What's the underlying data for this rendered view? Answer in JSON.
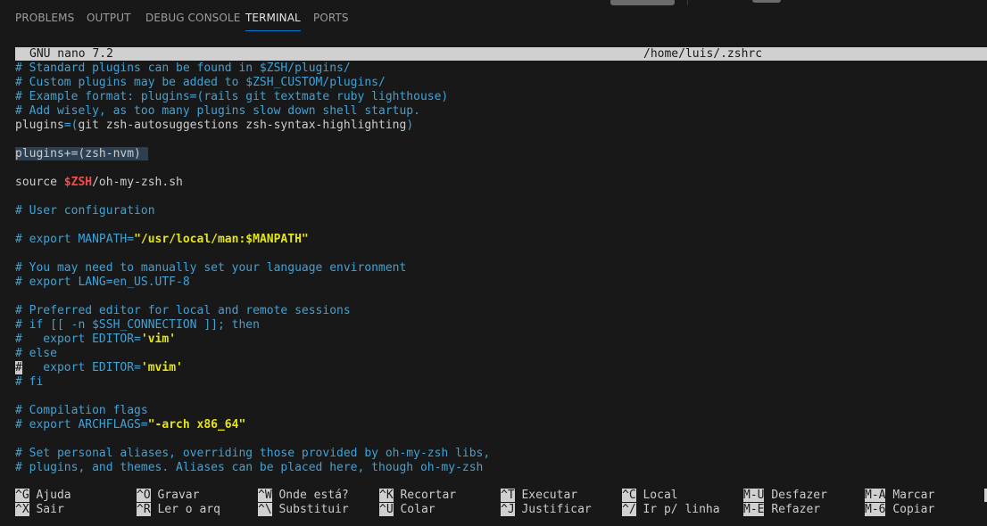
{
  "panel": {
    "tabs": [
      "PROBLEMS",
      "OUTPUT",
      "DEBUG CONSOLE",
      "TERMINAL",
      "PORTS"
    ],
    "active_tab": "TERMINAL"
  },
  "nano": {
    "app_title": "GNU nano 7.2",
    "file_path": "/home/luis/.zshrc"
  },
  "lines": {
    "l1": "# Standard plugins can be found in $ZSH/plugins/",
    "l2": "# Custom plugins may be added to $ZSH_CUSTOM/plugins/",
    "l3": "# Example format: plugins=(rails git textmate ruby lighthouse)",
    "l4": "# Add wisely, as too many plugins slow down shell startup.",
    "l5a": "plugins",
    "l5b": "=(",
    "l5c": "git zsh-autosuggestions zsh-syntax-highlighting",
    "l5d": ")",
    "l6": "plugins+=(zsh-nvm) ",
    "l7a": "source ",
    "l7b": "$ZSH",
    "l7c": "/oh-my-zsh.sh",
    "l8": "# User configuration",
    "l9a": "# export MANPATH=",
    "l9b": "\"/usr/local/man:$MANPATH\"",
    "l10": "# You may need to manually set your language environment",
    "l11": "# export LANG=en_US.UTF-8",
    "l12": "# Preferred editor for local and remote sessions",
    "l13": "# if [[ -n $SSH_CONNECTION ]]; then",
    "l14a": "#   export EDITOR=",
    "l14b": "'vim'",
    "l15": "# else",
    "l16a": "#",
    "l16b": "   export EDITOR=",
    "l16c": "'mvim'",
    "l17": "# fi",
    "l18": "# Compilation flags",
    "l19a": "# export ARCHFLAGS=",
    "l19b": "\"-arch x86_64\"",
    "l20": "# Set personal aliases, overriding those provided by oh-my-zsh libs,",
    "l21": "# plugins, and themes. Aliases can be placed here, though oh-my-zsh"
  },
  "shortcuts": [
    {
      "key": "^G",
      "label": "Ajuda"
    },
    {
      "key": "^X",
      "label": "Sair"
    },
    {
      "key": "^O",
      "label": "Gravar"
    },
    {
      "key": "^R",
      "label": "Ler o arq"
    },
    {
      "key": "^W",
      "label": "Onde está?"
    },
    {
      "key": "^\\",
      "label": "Substituir"
    },
    {
      "key": "^K",
      "label": "Recortar"
    },
    {
      "key": "^U",
      "label": "Colar"
    },
    {
      "key": "^T",
      "label": "Executar"
    },
    {
      "key": "^J",
      "label": "Justificar"
    },
    {
      "key": "^C",
      "label": "Local"
    },
    {
      "key": "^/",
      "label": "Ir p/ linha"
    },
    {
      "key": "M-U",
      "label": "Desfazer"
    },
    {
      "key": "M-E",
      "label": "Refazer"
    },
    {
      "key": "M-A",
      "label": "Marcar"
    },
    {
      "key": "M-6",
      "label": "Copiar"
    }
  ],
  "colors": {
    "background": "#181818",
    "comment": "#3fa2d7",
    "variable": "#f14c4c",
    "string": "#e5e510",
    "accent": "#0078d4"
  }
}
